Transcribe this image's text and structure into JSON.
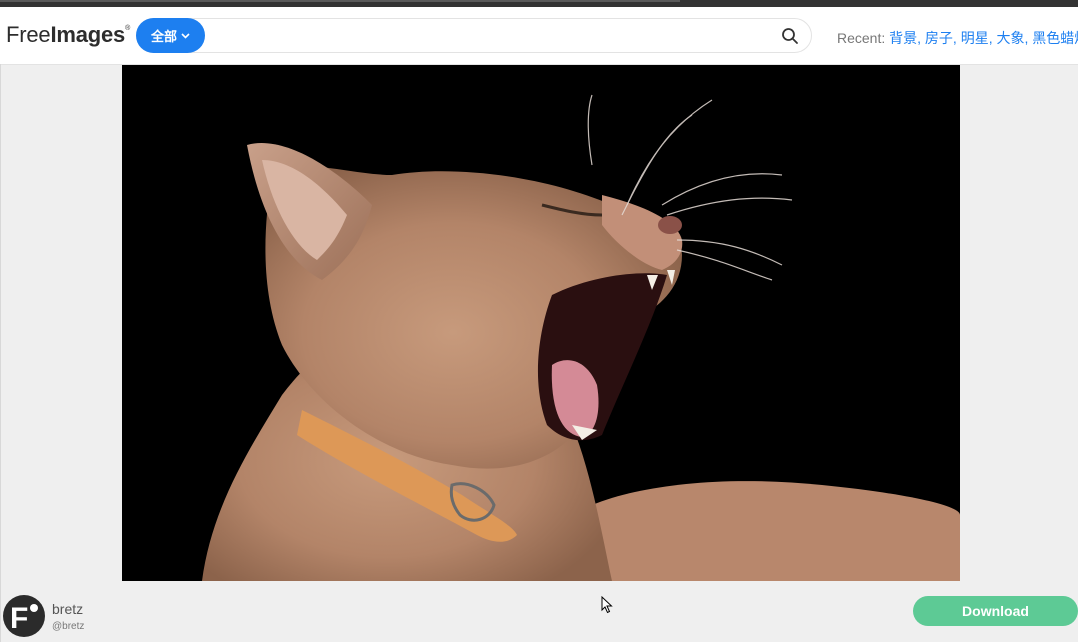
{
  "header": {
    "logo_light": "Free",
    "logo_bold": "Images",
    "logo_mark": "®",
    "search": {
      "category_label": "全部",
      "placeholder": "",
      "value": ""
    },
    "recent": {
      "label": "Recent:",
      "items": [
        "背景",
        "房子",
        "明星",
        "大象",
        "黑色蜡烛"
      ]
    }
  },
  "photo": {
    "description_icon": "yawning-cat-image"
  },
  "footer": {
    "author_name": "bretz",
    "author_handle": "@bretz",
    "download_label": "Download"
  },
  "colors": {
    "accent": "#1d7ff0",
    "download": "#5dca95",
    "header_bg": "#ffffff",
    "page_bg": "#efefef"
  }
}
